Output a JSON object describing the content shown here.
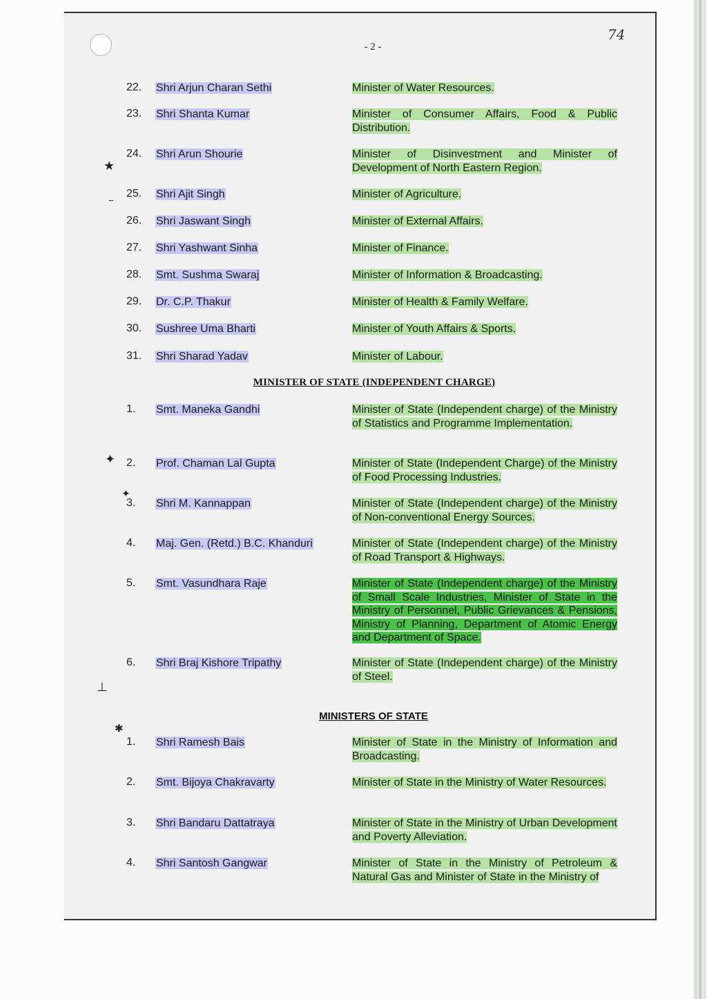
{
  "header": {
    "page_number": "- 2 -",
    "folio": "74"
  },
  "cabinet_ministers": [
    {
      "num": "22.",
      "name": "Shri Arjun Charan Sethi",
      "portfolio": "Minister of Water Resources."
    },
    {
      "num": "23.",
      "name": "Shri Shanta Kumar",
      "portfolio": "Minister of Consumer Affairs, Food & Public Distribution."
    },
    {
      "num": "24.",
      "name": "Shri Arun Shourie",
      "portfolio": "Minister of Disinvestment and Minister of Development of North Eastern Region."
    },
    {
      "num": "25.",
      "name": "Shri Ajit Singh",
      "portfolio": "Minister of Agriculture."
    },
    {
      "num": "26.",
      "name": "Shri Jaswant Singh",
      "portfolio": "Minister of External Affairs."
    },
    {
      "num": "27.",
      "name": "Shri Yashwant Sinha",
      "portfolio": "Minister of Finance."
    },
    {
      "num": "28.",
      "name": "Smt. Sushma Swaraj",
      "portfolio": "Minister of Information & Broadcasting."
    },
    {
      "num": "29.",
      "name": "Dr. C.P. Thakur",
      "portfolio": "Minister of Health & Family Welfare."
    },
    {
      "num": "30.",
      "name": "Sushree Uma Bharti",
      "portfolio": "Minister of Youth Affairs & Sports."
    },
    {
      "num": "31.",
      "name": "Shri Sharad Yadav",
      "portfolio": "Minister of Labour."
    }
  ],
  "independent_charge": {
    "title": "MINISTER OF STATE (INDEPENDENT CHARGE)",
    "items": [
      {
        "num": "1.",
        "name": "Smt. Maneka Gandhi",
        "portfolio": "Minister of State (Independent charge) of the Ministry of Statistics and Programme Implementation."
      },
      {
        "num": "2.",
        "name": "Prof. Chaman Lal Gupta",
        "portfolio": "Minister of State (Independent Charge) of the Ministry of Food Processing Industries."
      },
      {
        "num": "3.",
        "name": "Shri M. Kannappan",
        "portfolio": "Minister of State (Independent charge) of the Ministry of Non-conventional Energy Sources."
      },
      {
        "num": "4.",
        "name": "Maj. Gen. (Retd.) B.C. Khanduri",
        "portfolio": "Minister of State (Independent charge) of the Ministry of Road Transport & Highways."
      },
      {
        "num": "5.",
        "name": "Smt. Vasundhara Raje",
        "portfolio": "Minister of State (Independent charge) of the Ministry of Small Scale Industries, Minister of State in the Ministry of Personnel, Public Grievances & Pensions, Ministry of Planning, Department of Atomic Energy and Department of Space."
      },
      {
        "num": "6.",
        "name": "Shri Braj Kishore Tripathy",
        "portfolio": "Minister of State (Independent charge) of the Ministry of Steel."
      }
    ]
  },
  "ministers_of_state": {
    "title": "MINISTERS OF STATE",
    "items": [
      {
        "num": "1.",
        "name": "Shri Ramesh Bais",
        "portfolio": "Minister of State in the Ministry of Information and Broadcasting."
      },
      {
        "num": "2.",
        "name": "Smt. Bijoya Chakravarty",
        "portfolio": "Minister of State in the Ministry of Water Resources."
      },
      {
        "num": "3.",
        "name": "Shri Bandaru Dattatraya",
        "portfolio": "Minister of State in the Ministry of Urban Development and Poverty Alleviation."
      },
      {
        "num": "4.",
        "name": "Shri Santosh Gangwar",
        "portfolio": "Minister of State in the Ministry of Petroleum & Natural Gas and Minister of State in the Ministry of"
      }
    ]
  },
  "colors": {
    "name_highlight": "#c7c8f3",
    "portfolio_highlight": "#b6e3a4",
    "strong_highlight": "#48c247"
  }
}
